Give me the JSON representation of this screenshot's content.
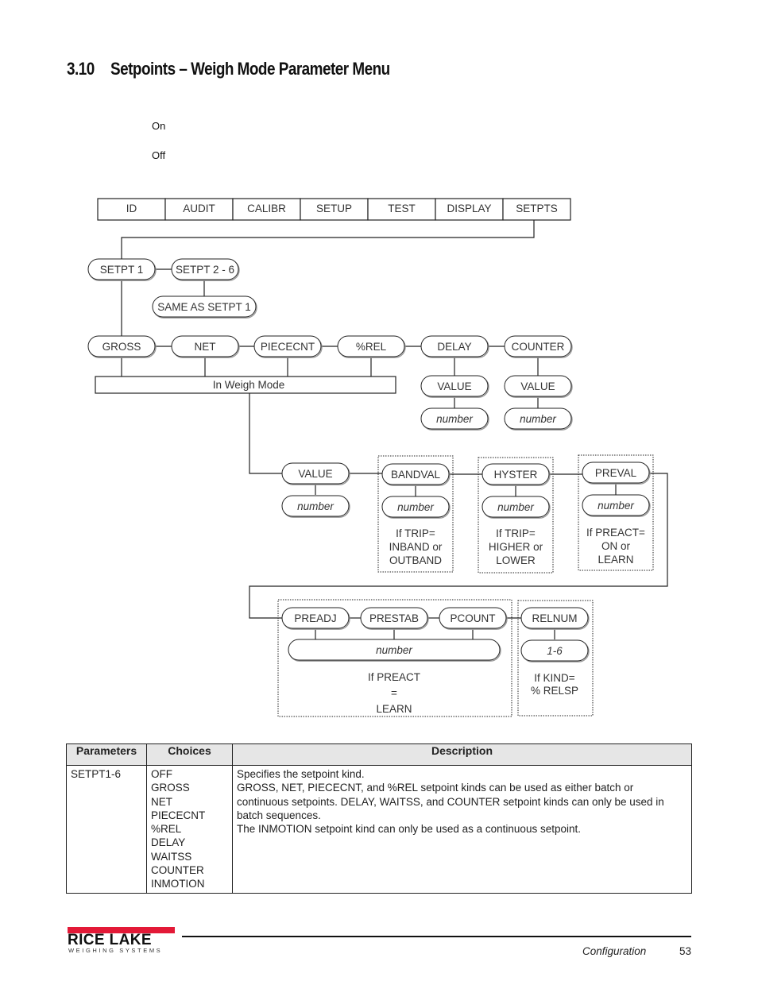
{
  "page": {
    "section_number": "3.10",
    "section_title": "Setpoints – Weigh Mode Parameter Menu",
    "notes": [
      "On",
      "Off"
    ]
  },
  "diagram": {
    "top_menu": [
      "ID",
      "AUDIT",
      "CALIBR",
      "SETUP",
      "TEST",
      "DISPLAY",
      "SETPTS"
    ],
    "setpt1": "SETPT 1",
    "setpt2_6": "SETPT 2 - 6",
    "same_as": "SAME AS SETPT 1",
    "kinds": [
      "GROSS",
      "NET",
      "PIECECNT",
      "%REL",
      "DELAY",
      "COUNTER"
    ],
    "in_weigh_mode": "In Weigh Mode",
    "delay_value": "VALUE",
    "delay_number": "number",
    "counter_value": "VALUE",
    "counter_number": "number",
    "row3": {
      "value": "VALUE",
      "value_number": "number",
      "bandval": "BANDVAL",
      "bandval_number": "number",
      "bandval_cond": [
        "If TRIP=",
        "INBAND or",
        "OUTBAND"
      ],
      "hyster": "HYSTER",
      "hyster_number": "number",
      "hyster_cond": [
        "If TRIP=",
        "HIGHER or",
        "LOWER"
      ],
      "preval": "PREVAL",
      "preval_number": "number",
      "preval_cond": [
        "If PREACT=",
        "ON or",
        "LEARN"
      ]
    },
    "row4": {
      "preadj": "PREADJ",
      "prestab": "PRESTAB",
      "pcount": "PCOUNT",
      "shared_number": "number",
      "pre_cond": [
        "If PREACT",
        "=",
        "LEARN"
      ],
      "relnum": "RELNUM",
      "relnum_range": "1-6",
      "relnum_cond": [
        "If KIND=",
        "% RELSP"
      ]
    }
  },
  "table": {
    "headers": [
      "Parameters",
      "Choices",
      "Description"
    ],
    "rows": [
      {
        "parameter": "SETPT1-6",
        "choices": [
          "OFF",
          "GROSS",
          "NET",
          "PIECECNT",
          "%REL",
          "DELAY",
          "WAITSS",
          "COUNTER",
          "INMOTION"
        ],
        "description": [
          "Specifies the setpoint kind.",
          "GROSS, NET, PIECECNT, and %REL setpoint kinds can be used as either batch or continuous setpoints. DELAY, WAITSS, and COUNTER setpoint kinds can only be used in batch sequences.",
          "The INMOTION setpoint kind can only be used as a continuous setpoint."
        ]
      }
    ]
  },
  "footer": {
    "brand": "RICE LAKE",
    "brand_sub": "WEIGHING SYSTEMS",
    "brand_color": "#e31937",
    "section": "Configuration",
    "page_number": "53"
  }
}
